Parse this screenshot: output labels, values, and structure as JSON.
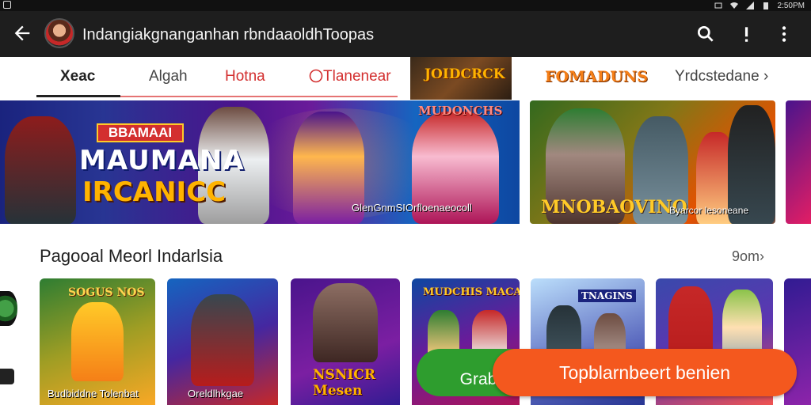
{
  "status_bar": {
    "icons": [
      "image-icon",
      "mail-icon",
      "wifi-icon",
      "signal-icon",
      "battery-icon"
    ],
    "time": "2:50PM"
  },
  "app_bar": {
    "title": "Indangiakgnanganhan rbndaaoldhToopas",
    "icons": [
      "back-arrow-icon",
      "search-icon",
      "alert-icon",
      "more-vert-icon"
    ]
  },
  "tabs": [
    {
      "label": "Xeac",
      "active": true,
      "color": "#222222"
    },
    {
      "label": "Algah",
      "active": false,
      "color": "#444444"
    },
    {
      "label": "Hotna",
      "active": false,
      "color": "#d32f2f"
    },
    {
      "label": "Tlanenear",
      "active": false,
      "color": "#d32f2f",
      "icon": "circle-r-icon"
    },
    {
      "label": "JOIDCRCK",
      "active": false
    },
    {
      "label": "FOMADUNS",
      "active": false
    },
    {
      "label": "Yrdcstedane ›",
      "active": false,
      "color": "#444444"
    }
  ],
  "banners": [
    {
      "badge": "BBAMAAI",
      "headline_1": "MAUMANA",
      "headline_2": "IRCANICC",
      "logo": "MUDONCHS",
      "caption": "GlenGnmSIOrfloenaeocoll"
    },
    {
      "headline": "MNOBAOVINO",
      "caption": "Byarcor lesoneane"
    }
  ],
  "section": {
    "title": "Pagooal Meorl Indarlsia",
    "more_link": "9om›"
  },
  "cards": [
    {
      "title": "SOGUS NOS",
      "caption": "Budbiddne Tolenbat",
      "colors": [
        "#2e7d32",
        "#f9a825"
      ]
    },
    {
      "title": "",
      "caption": "Oreldlhkgae",
      "colors": [
        "#1565c0",
        "#c62828"
      ]
    },
    {
      "title": "NSNICR\nMesen",
      "caption": "",
      "colors": [
        "#4a148c",
        "#7b1fa2"
      ]
    },
    {
      "title": "MUDCHIS MACAN",
      "caption": "",
      "colors": [
        "#0d47a1",
        "#6a1b9a"
      ]
    },
    {
      "title": "TNAGINS",
      "caption": "",
      "colors": [
        "#e3f2fd",
        "#5c6bc0"
      ]
    },
    {
      "title": "",
      "caption": "",
      "colors": [
        "#3949ab",
        "#ef5350"
      ]
    },
    {
      "title": "",
      "caption": "",
      "colors": [
        "#311b92",
        "#8e24aa"
      ]
    }
  ],
  "buttons": {
    "secondary": "Grab",
    "primary": "Topblarnbeert benien"
  },
  "colors": {
    "app_bar": "#1e1e1e",
    "primary_button": "#f4581e",
    "secondary_button": "#2e9d2e",
    "tab_underline": "#e57373"
  }
}
